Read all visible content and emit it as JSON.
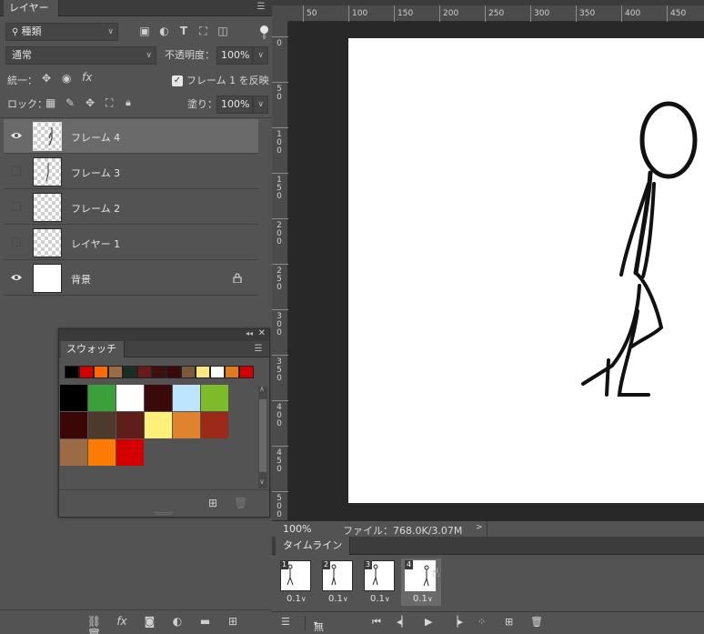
{
  "layers_panel": {
    "tab": "レイヤー",
    "filter_kind": "種類",
    "blend_mode": "通常",
    "opacity_label": "不透明度：",
    "opacity_value": "100%",
    "unify_label": "統一：",
    "propagate_label": "フレーム 1 を反映",
    "lock_label": "ロック：",
    "fill_label": "塗り：",
    "fill_value": "100%",
    "layers": [
      {
        "name": "フレーム 4",
        "visible": true,
        "selected": true,
        "thumb": "transparent"
      },
      {
        "name": "フレーム 3",
        "visible": false,
        "selected": false,
        "thumb": "transparent"
      },
      {
        "name": "フレーム 2",
        "visible": false,
        "selected": false,
        "thumb": "transparent"
      },
      {
        "name": "レイヤー 1",
        "visible": false,
        "selected": false,
        "thumb": "transparent"
      },
      {
        "name": "背景",
        "visible": true,
        "selected": false,
        "thumb": "white",
        "locked": true
      }
    ]
  },
  "swatches_panel": {
    "tab": "スウォッチ",
    "recent_colors": [
      "#000000",
      "#d40000",
      "#ff6a00",
      "#9b6b43",
      "#1d2d22",
      "#6a1a1a",
      "#401010",
      "#3a0a0a",
      "#7a5a3a",
      "#ffe680",
      "#ffffff",
      "#e07a1f",
      "#d40000"
    ],
    "colors": [
      "#000000",
      "#3aa03a",
      "#ffffff",
      "#3a0a0a",
      "#bde5ff",
      "#7cbb2a",
      "#3a0606",
      "#4d3a2a",
      "#5e1e1a",
      "#fff07a",
      "#e0832f",
      "#9b2a18",
      "#9a6b44",
      "#ff7a00",
      "#d40000"
    ]
  },
  "canvas": {
    "ruler_h_labels": [
      "50",
      "100",
      "150",
      "200",
      "250",
      "300",
      "350",
      "400",
      "450"
    ],
    "ruler_v_labels": [
      "0",
      "50",
      "100",
      "150",
      "200",
      "250",
      "300",
      "350",
      "400",
      "450",
      "500"
    ],
    "zoom": "100%",
    "file_info": "ファイル：768.0K/3.07M"
  },
  "timeline": {
    "tab": "タイムライン",
    "frames": [
      {
        "num": "1",
        "delay": "0.1",
        "selected": false
      },
      {
        "num": "2",
        "delay": "0.1",
        "selected": false
      },
      {
        "num": "3",
        "delay": "0.1",
        "selected": false
      },
      {
        "num": "4",
        "delay": "0.1",
        "selected": true
      }
    ],
    "loop": "無限"
  }
}
